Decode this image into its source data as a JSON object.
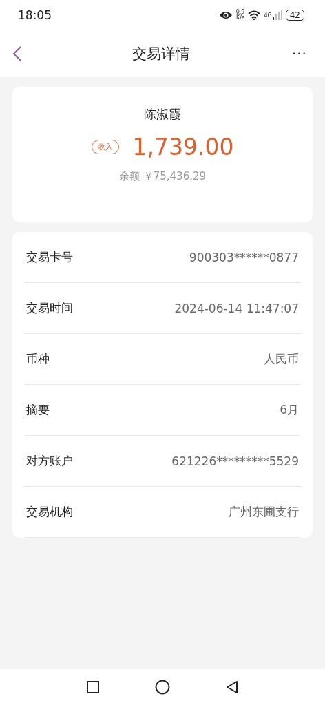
{
  "status_bar": {
    "time": "18:05",
    "speed": "0.9\nK/s",
    "network": "4G",
    "battery": "42"
  },
  "header": {
    "title": "交易详情",
    "more": "···"
  },
  "summary": {
    "name": "陈淑霞",
    "tag": "收入",
    "amount": "1,739.00",
    "balance": "余额 ￥75,436.29"
  },
  "details": [
    {
      "label": "交易卡号",
      "value": "900303******0877"
    },
    {
      "label": "交易时间",
      "value": "2024-06-14 11:47:07"
    },
    {
      "label": "币种",
      "value": "人民币"
    },
    {
      "label": "摘要",
      "value": "6月"
    },
    {
      "label": "对方账户",
      "value": "621226*********5529"
    },
    {
      "label": "交易机构",
      "value": "广州东圃支行"
    }
  ]
}
